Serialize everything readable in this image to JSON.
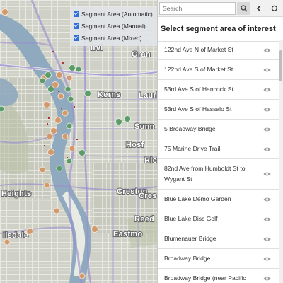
{
  "map": {
    "labels": [
      "Irvi",
      "Gran",
      "Kerns",
      "Lauri",
      "Sunn",
      "Rich",
      "Hosf",
      "Creston",
      "Heights",
      "Reed",
      "Cres",
      "Eastmo",
      "Ilsdale"
    ],
    "legend": [
      {
        "label": "Segment Area (Automatic)",
        "checked": true
      },
      {
        "label": "Segment Area (Manual)",
        "checked": true
      },
      {
        "label": "Segment Area (Mixed)",
        "checked": true
      }
    ],
    "colors": {
      "automatic": "#6fa56a",
      "manual": "#d29a6c",
      "river": "#8fa9bf",
      "route": "#9b8fcf"
    }
  },
  "sidebar": {
    "search_placeholder": "Search",
    "search_icon": "search-icon",
    "back_icon": "chevron-left-icon",
    "refresh_icon": "refresh-icon",
    "title": "Select segment area of interest",
    "items": [
      {
        "label": "122nd Ave N of Market St"
      },
      {
        "label": "122nd Ave S of Market St"
      },
      {
        "label": "53rd Ave S of Hancock St"
      },
      {
        "label": "53rd Ave S of Hassalo St"
      },
      {
        "label": "5 Broadway Bridge"
      },
      {
        "label": "75 Marine Drive Trail"
      },
      {
        "label": "82nd Ave from Humboldt St to Wygant St"
      },
      {
        "label": "Blue Lake Demo Garden"
      },
      {
        "label": "Blue Lake Disc Golf"
      },
      {
        "label": "Blumenauer Bridge"
      },
      {
        "label": "Broadway Bridge"
      },
      {
        "label": "Broadway Bridge (near Pacific"
      }
    ],
    "item_icon": "eye-icon"
  }
}
